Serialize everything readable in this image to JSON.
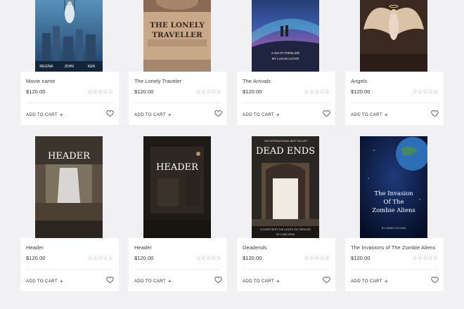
{
  "products": [
    {
      "name": "Movie name",
      "price": "$120.00",
      "rating_stars": 0,
      "cover_texts": [
        "REGINA",
        "JOHN",
        "KEN"
      ]
    },
    {
      "name": "The Lonely Traveler",
      "price": "$120.00",
      "rating_stars": 0,
      "cover_texts": [
        "THE LONELY",
        "TRAVELLER"
      ]
    },
    {
      "name": "The Arrivals",
      "price": "$120.00",
      "rating_stars": 0,
      "cover_texts": [
        "A SCI-FI THRILLER",
        "BY LUCAS LLOYD"
      ]
    },
    {
      "name": "Angels",
      "price": "$120.00",
      "rating_stars": 0,
      "cover_texts": []
    },
    {
      "name": "Header",
      "price": "$120.00",
      "rating_stars": 0,
      "cover_texts": [
        "HEADER"
      ]
    },
    {
      "name": "Header",
      "price": "$120.00",
      "rating_stars": 0,
      "cover_texts": [
        "HEADER"
      ]
    },
    {
      "name": "Deadends",
      "price": "$120.00",
      "rating_stars": 0,
      "cover_texts": [
        "THE INTERNATIONAL BEST SELLER",
        "DEAD ENDS",
        "A SLEEP WITH THE LIGHTS ON THRILLER",
        "BY LUKE GRIM"
      ]
    },
    {
      "name": "The Invasions of The Zombie Aliens",
      "price": "$120.00",
      "rating_stars": 0,
      "cover_texts": [
        "The Invasion",
        "Of The",
        "Zombie Aliens",
        "BY JAMES COLLINS"
      ]
    }
  ],
  "labels": {
    "add_to_cart": "ADD TO CART",
    "add_icon": "+",
    "empty_stars": "☆☆☆☆☆"
  },
  "icons": {
    "wishlist": "heart-outline-icon"
  }
}
